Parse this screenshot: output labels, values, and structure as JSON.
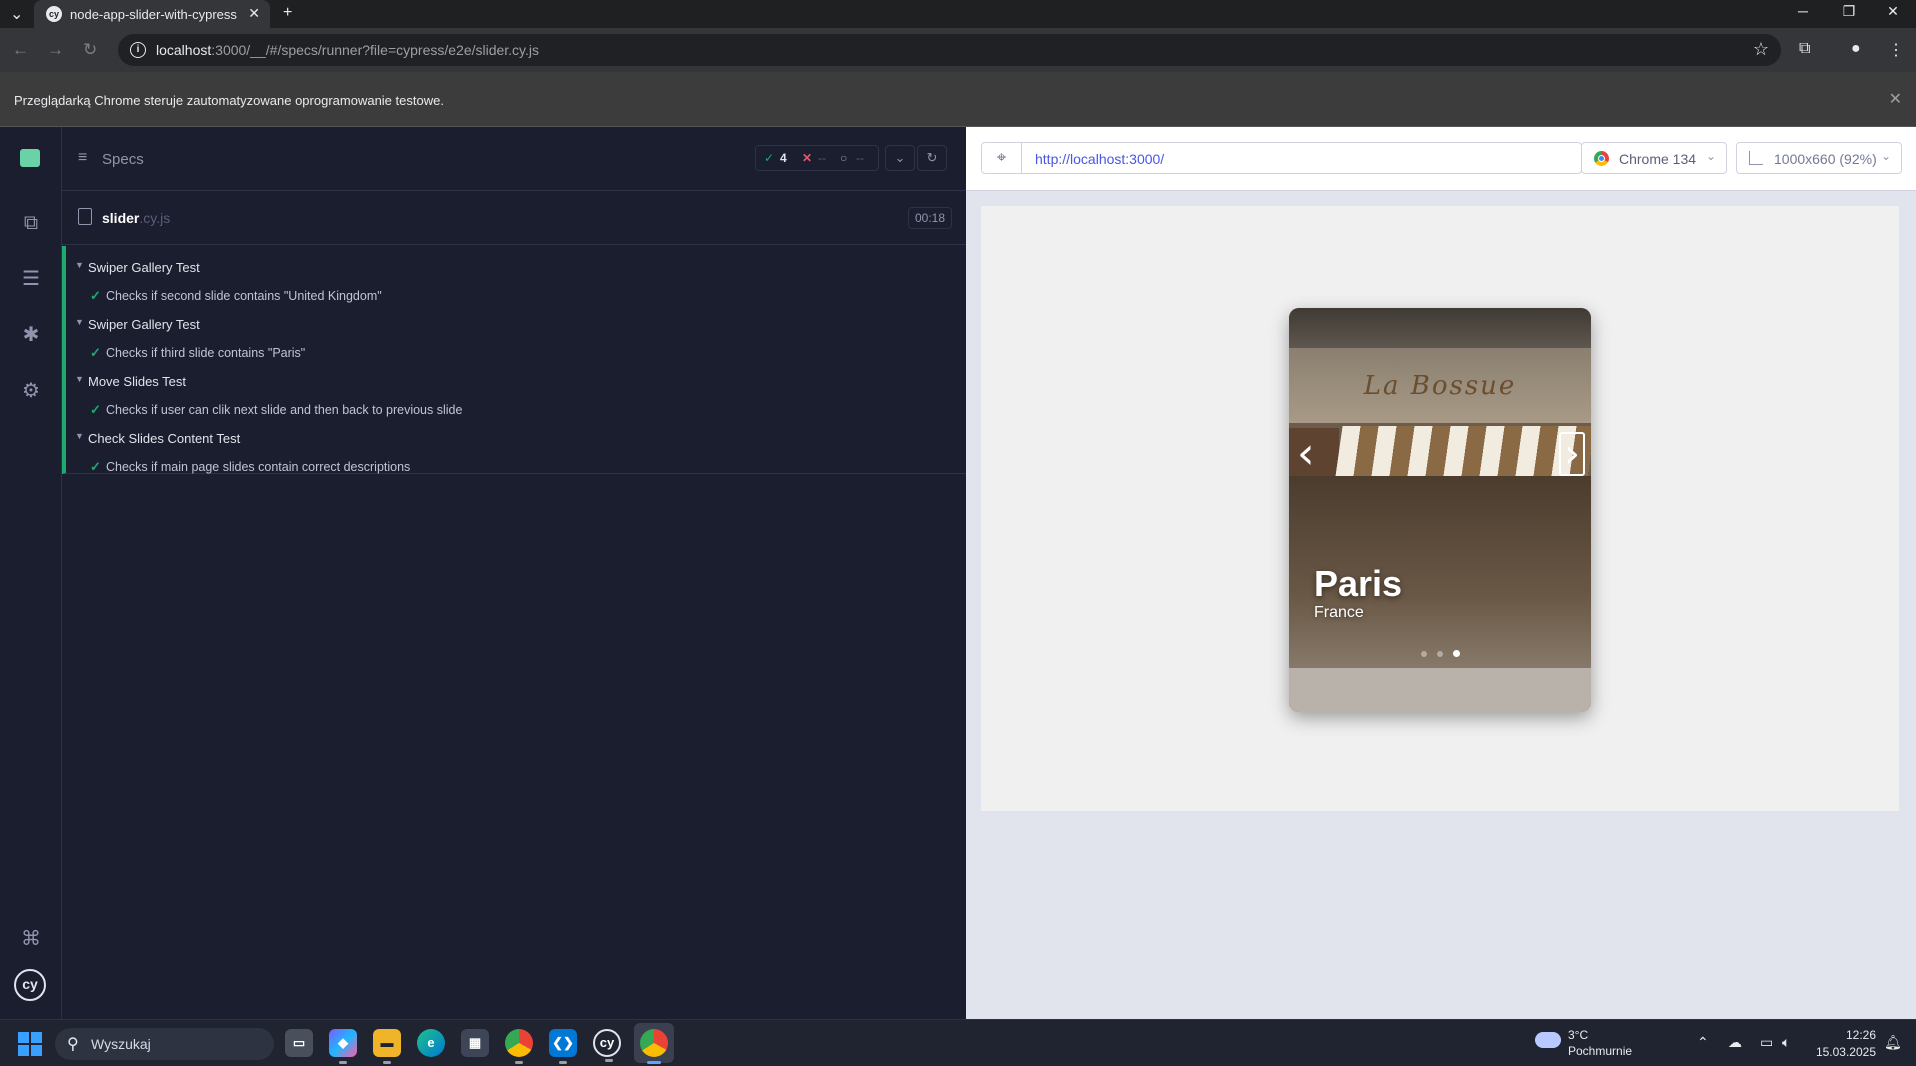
{
  "browser": {
    "tab_title": "node-app-slider-with-cypress",
    "tab_favicon": "cy",
    "new_tab": "+",
    "url_host": "localhost",
    "url_rest": ":3000/__/#/specs/runner?file=cypress/e2e/slider.cy.js",
    "infobar_message": "Przeglądarką Chrome steruje zautomatyzowane oprogramowanie testowe."
  },
  "reporter": {
    "header_title": "Specs",
    "passed_count": "4",
    "failed_count": "--",
    "pending_count": "--",
    "spec_name": "slider",
    "spec_ext": ".cy.js",
    "duration": "00:18",
    "suites": [
      {
        "title": "Swiper Gallery Test",
        "tests": [
          "Checks if second slide contains \"United Kingdom\""
        ]
      },
      {
        "title": "Swiper Gallery Test",
        "tests": [
          "Checks if third slide contains \"Paris\""
        ]
      },
      {
        "title": "Move Slides Test",
        "tests": [
          "Checks if user can clik next slide and then back to previous slide"
        ]
      },
      {
        "title": "Check Slides Content Test",
        "tests": [
          "Checks if main page slides contain correct descriptions"
        ]
      }
    ]
  },
  "aut": {
    "url": "http://localhost:3000/",
    "browser": "Chrome 134",
    "viewport": "1000x660 (92%)",
    "slide": {
      "sign_text": "La Bossue",
      "title": "Paris",
      "subtitle": "France",
      "dots": 3,
      "active_dot": 3
    }
  },
  "taskbar": {
    "search_label": "Wyszukaj",
    "weather_temp": "3°C",
    "weather_desc": "Pochmurnie",
    "time": "12:26",
    "date": "15.03.2025",
    "apps": [
      "task-view",
      "m365",
      "file-explorer",
      "edge",
      "store",
      "chrome",
      "vscode",
      "cypress",
      "chrome-active"
    ]
  },
  "colors": {
    "pass": "#1fa971",
    "fail": "#e45770",
    "url_link": "#4956e3"
  }
}
